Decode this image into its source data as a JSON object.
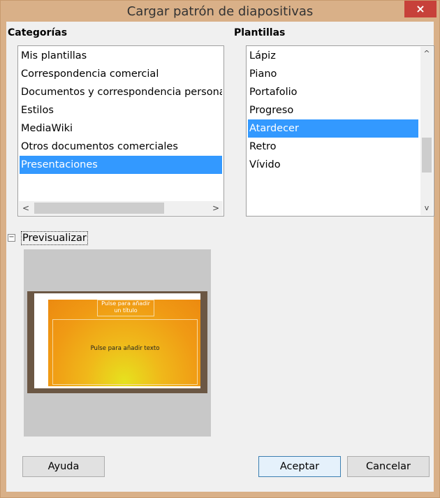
{
  "window": {
    "title": "Cargar patrón de diapositivas",
    "close_label": "×"
  },
  "categories": {
    "label": "Categorías",
    "items": [
      {
        "label": "Mis plantillas"
      },
      {
        "label": "Correspondencia comercial"
      },
      {
        "label": "Documentos y correspondencia personal"
      },
      {
        "label": "Estilos"
      },
      {
        "label": "MediaWiki"
      },
      {
        "label": "Otros documentos comerciales"
      },
      {
        "label": "Presentaciones"
      }
    ],
    "selected": "Presentaciones",
    "scroll_left_icon": "<",
    "scroll_right_icon": ">"
  },
  "templates": {
    "label": "Plantillas",
    "items": [
      {
        "label": "Lápiz"
      },
      {
        "label": "Piano"
      },
      {
        "label": "Portafolio"
      },
      {
        "label": "Progreso"
      },
      {
        "label": "Atardecer"
      },
      {
        "label": "Retro"
      },
      {
        "label": "Vívido"
      }
    ],
    "selected": "Atardecer",
    "scroll_up_icon": "^",
    "scroll_down_icon": "v"
  },
  "preview": {
    "expander_label": "Previsualizar",
    "expander_icon": "⊟",
    "slide_title": "Pulse para añadir un título",
    "slide_body": "Pulse para añadir texto"
  },
  "buttons": {
    "help": "Ayuda",
    "ok": "Aceptar",
    "cancel": "Cancelar"
  },
  "colors": {
    "title_bar": "#d9b088",
    "close_button": "#c7413a",
    "selection": "#3399ff",
    "slide_orange": "#f09a14"
  }
}
